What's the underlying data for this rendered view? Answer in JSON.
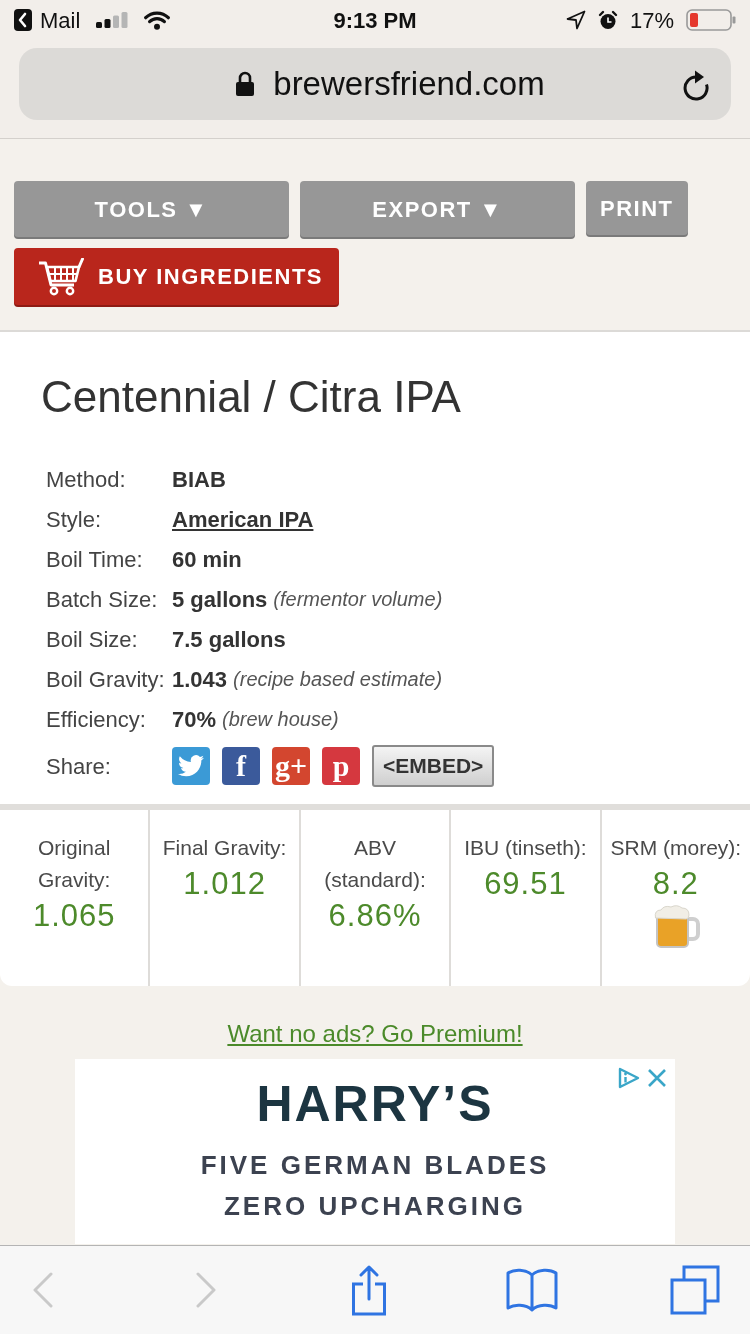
{
  "status_bar": {
    "back_label": "Mail",
    "time": "9:13 PM",
    "battery": "17%"
  },
  "address_bar": {
    "url": "brewersfriend.com"
  },
  "actions": [
    {
      "label": "TOOLS ▼",
      "kind": "menu"
    },
    {
      "label": "EXPORT ▼",
      "kind": "menu"
    },
    {
      "label": "PRINT",
      "kind": "plain"
    },
    {
      "label": "BUY INGREDIENTS",
      "kind": "cart"
    }
  ],
  "recipe": {
    "title": "Centennial / Citra IPA",
    "details": [
      {
        "label": "Method:",
        "value": "BIAB",
        "kind": "text"
      },
      {
        "label": "Style:",
        "value": "American IPA",
        "kind": "link"
      },
      {
        "label": "Boil Time:",
        "value": "60 min",
        "kind": "text"
      },
      {
        "label": "Batch Size:",
        "value": "5 gallons",
        "note": "(fermentor volume)",
        "kind": "text"
      },
      {
        "label": "Boil Size:",
        "value": "7.5 gallons",
        "kind": "text"
      },
      {
        "label": "Boil Gravity:",
        "value": "1.043",
        "note": "(recipe based estimate)",
        "kind": "text"
      },
      {
        "label": "Efficiency:",
        "value": "70%",
        "note": "(brew house)",
        "kind": "text"
      }
    ],
    "share": {
      "label": "Share:",
      "buttons": [
        {
          "kind": "bird",
          "color": "#3b9ad6"
        },
        {
          "kind": "letter",
          "glyph": "f",
          "color": "#3b5a9b"
        },
        {
          "kind": "letter",
          "glyph": "g+",
          "color": "#d3462f"
        },
        {
          "kind": "letter",
          "glyph": "p",
          "color": "#d5383f"
        }
      ],
      "embed": "<EMBED>"
    }
  },
  "stats": [
    {
      "label": "Original Gravity:",
      "value": "1.065",
      "kind": "plain"
    },
    {
      "label": "Final Gravity:",
      "value": "1.012",
      "kind": "plain"
    },
    {
      "label": "ABV (standard):",
      "value": "6.86%",
      "kind": "plain"
    },
    {
      "label": "IBU (tinseth):",
      "value": "69.51",
      "kind": "plain"
    },
    {
      "label": "SRM (morey):",
      "value": "8.2",
      "kind": "color"
    }
  ],
  "premium_link": "Want no ads? Go Premium!",
  "ad": {
    "headline": "HARRY’S",
    "lines": [
      "FIVE GERMAN BLADES",
      "ZERO UPCHARGING"
    ]
  },
  "browser_toolbar": [
    {
      "kind": "back",
      "disabled": true
    },
    {
      "kind": "forward",
      "disabled": true
    },
    {
      "kind": "share",
      "disabled": false
    },
    {
      "kind": "bookmarks",
      "disabled": false
    },
    {
      "kind": "tabs",
      "disabled": false
    }
  ]
}
